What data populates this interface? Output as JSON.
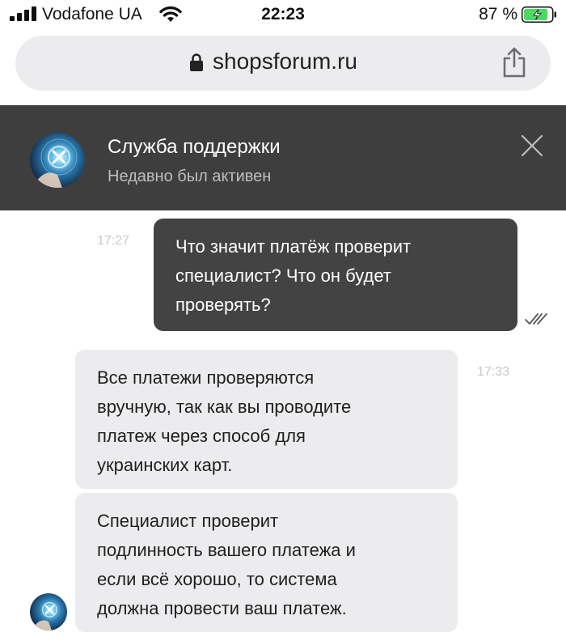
{
  "status_bar": {
    "carrier": "Vodafone UA",
    "time": "22:23",
    "battery_percent": "87 %",
    "battery_level": 0.87,
    "battery_charging": true,
    "battery_color": "#4cd964"
  },
  "browser": {
    "url": "shopsforum.ru",
    "secure": true,
    "icons": [
      "lock-icon",
      "share-icon"
    ]
  },
  "chat_header": {
    "title": "Служба поддержки",
    "status": "Недавно был активен",
    "icons": [
      "avatar",
      "close-icon"
    ]
  },
  "messages": [
    {
      "direction": "outgoing",
      "time": "17:27",
      "lines": [
        "Что значит платёж проверит",
        "специалист? Что он будет",
        "проверять?"
      ],
      "read": true
    },
    {
      "direction": "incoming",
      "time": "17:33",
      "lines": [
        "Все платежи проверяются",
        "вручную, так как вы проводите",
        "платеж через способ для",
        "украинских карт."
      ]
    },
    {
      "direction": "incoming",
      "lines": [
        "Специалист проверит",
        "подлинность вашего платежа и",
        "если всё хорошо, то система",
        "должна провести ваш платеж."
      ]
    }
  ],
  "colors": {
    "header_bg": "#3e3e3e",
    "outgoing_bubble": "#434343",
    "incoming_bubble": "#ececee",
    "url_bar": "#ececee"
  }
}
